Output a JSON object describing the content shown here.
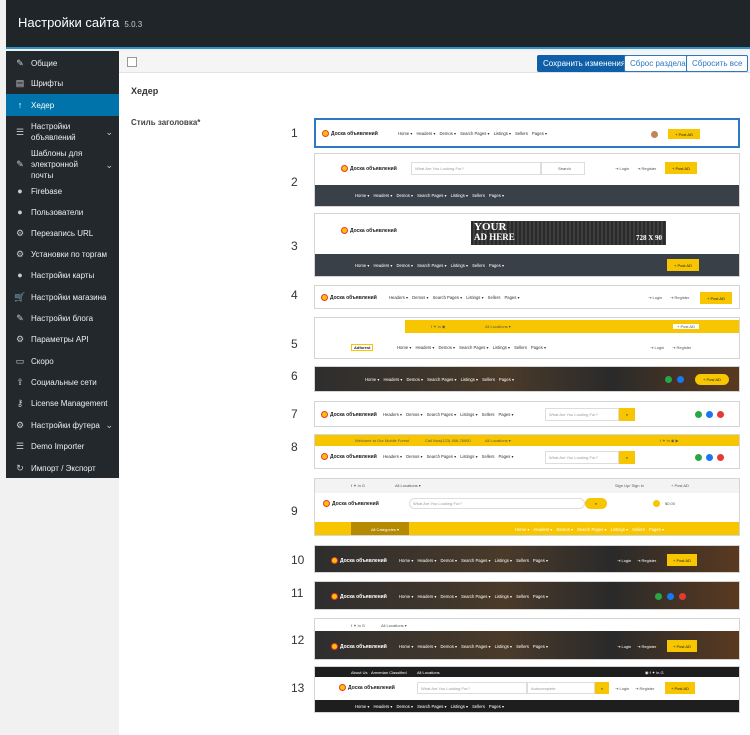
{
  "header": {
    "title": "Настройки сайта",
    "version": "5.0.3"
  },
  "sidebar": {
    "items": [
      {
        "label": "Общие",
        "icon": "wrench-icon"
      },
      {
        "label": "Шрифты",
        "icon": "document-icon"
      },
      {
        "label": "Хедер",
        "icon": "arrow-up-icon"
      },
      {
        "label": "Настройки объявлений",
        "icon": "sliders-icon"
      },
      {
        "label": "Шаблоны для электронной почты",
        "icon": "pencil-icon"
      },
      {
        "label": "Firebase",
        "icon": "circle-icon"
      },
      {
        "label": "Пользователи",
        "icon": "circle-icon"
      },
      {
        "label": "Перезапись URL",
        "icon": "cogs-icon"
      },
      {
        "label": "Установки по торгам",
        "icon": "cogs-icon"
      },
      {
        "label": "Настройки карты",
        "icon": "map-pin-icon"
      },
      {
        "label": "Настройки магазина",
        "icon": "cart-icon"
      },
      {
        "label": "Настройки блога",
        "icon": "edit-icon"
      },
      {
        "label": "Параметры API",
        "icon": "cogs-icon"
      },
      {
        "label": "Скоро",
        "icon": "monitor-icon"
      },
      {
        "label": "Социальные сети",
        "icon": "share-icon"
      },
      {
        "label": "License Management",
        "icon": "key-icon"
      },
      {
        "label": "Настройки футера",
        "icon": "cogs-icon"
      },
      {
        "label": "Demo Importer",
        "icon": "list-icon"
      },
      {
        "label": "Импорт / Экспорт",
        "icon": "refresh-icon"
      }
    ]
  },
  "toolbar": {
    "save": "Сохранить изменения",
    "reset_section": "Сброс раздела",
    "reset_all": "Сбросить все"
  },
  "main": {
    "section_title": "Хедер",
    "field_label": "Стиль заголовка*"
  },
  "styles": [
    "1",
    "2",
    "3",
    "4",
    "5",
    "6",
    "7",
    "8",
    "9",
    "10",
    "11",
    "12",
    "13"
  ],
  "preview": {
    "logo": "Доска объявлений",
    "nav": [
      "Home ▾",
      "Headers ▾",
      "Demos ▾",
      "Search Pages ▾",
      "Listings ▾",
      "Sellers",
      "Pages ▾"
    ],
    "nav_short": [
      "Headers ▾",
      "Demos ▾",
      "Search Pages ▾",
      "Listings ▾",
      "Sellers",
      "Pages ▾"
    ],
    "post_ad": "+ Post AD",
    "search_placeholder": "What Are You Looking For?",
    "search_btn": "Search",
    "login": "Login",
    "register": "Register",
    "all_locations": "All Locations",
    "all_categories": "All Categories ▾",
    "signup": "Sign Up/ Sign In",
    "price": "$0.00",
    "welcome": "Welcome to Our Mobile Forest",
    "phone": "Call Now(123) 456-78900",
    "about": "About Us",
    "armenian": "Armenian Classified",
    "autocomplete": "Autocomplete",
    "ad_your": "YOUR",
    "ad_here": "AD HERE",
    "ad_size": "728 X 90",
    "adforest": "Adforest"
  }
}
